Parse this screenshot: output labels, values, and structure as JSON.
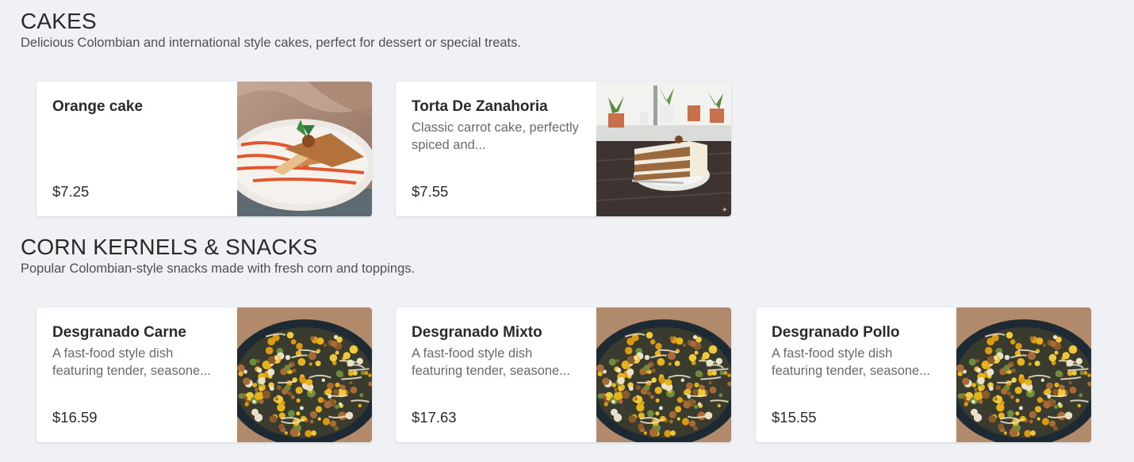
{
  "sections": [
    {
      "title": "CAKES",
      "description": "Delicious Colombian and international style cakes, perfect for dessert or special treats.",
      "items": [
        {
          "name": "Orange cake",
          "description": "",
          "price": "$7.25",
          "image": "orange-cake-photo"
        },
        {
          "name": "Torta De Zanahoria",
          "description": "Classic carrot cake, perfectly spiced and...",
          "price": "$7.55",
          "image": "carrot-cake-photo"
        }
      ]
    },
    {
      "title": "CORN KERNELS & SNACKS",
      "description": "Popular Colombian-style snacks made with fresh corn and toppings.",
      "items": [
        {
          "name": "Desgranado Carne",
          "description": "A fast-food style dish featuring tender, seasone...",
          "price": "$16.59",
          "image": "desgranado-photo"
        },
        {
          "name": "Desgranado Mixto",
          "description": "A fast-food style dish featuring tender, seasone...",
          "price": "$17.63",
          "image": "desgranado-photo"
        },
        {
          "name": "Desgranado Pollo",
          "description": "A fast-food style dish featuring tender, seasone...",
          "price": "$15.55",
          "image": "desgranado-photo"
        }
      ]
    }
  ],
  "colors": {
    "background": "#f0f1f5",
    "card": "#ffffff",
    "text": "#2a2a2a",
    "muted": "#6a6a6a"
  }
}
